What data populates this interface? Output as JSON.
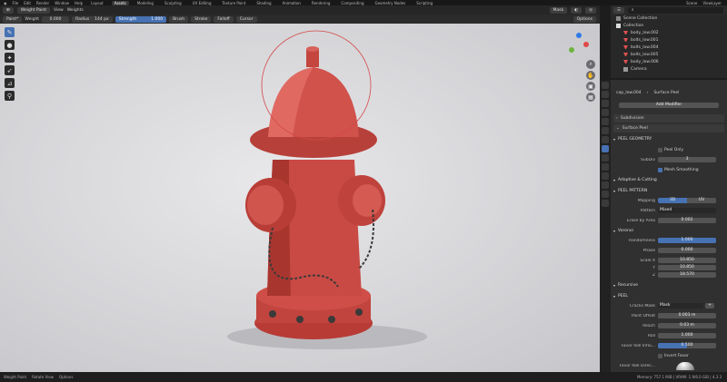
{
  "menubar": {
    "items": [
      "File",
      "Edit",
      "Render",
      "Window",
      "Help"
    ],
    "workspaces": [
      "Layout",
      "Assets",
      "Modeling",
      "Sculpting",
      "UV Editing",
      "Texture Paint",
      "Shading",
      "Animation",
      "Rendering",
      "Compositing",
      "Geometry Nodes",
      "Scripting"
    ],
    "active_workspace": "Assets",
    "right": [
      "Scene",
      "ViewLayer"
    ]
  },
  "header": {
    "mode": "Weight Paint",
    "menus": [
      "View",
      "Weights"
    ],
    "mask_label": "Mask"
  },
  "tool_header": {
    "brush": "Paint*",
    "weight_label": "Weight",
    "weight_value": "0.000",
    "radius_label": "Radius",
    "radius_value": "144 px",
    "strength_label": "Strength",
    "strength_value": "1.000",
    "dropdowns": [
      "Brush",
      "Stroke",
      "Falloff",
      "Cursor"
    ],
    "options": "Options"
  },
  "outliner": {
    "title": "Scene Collection",
    "collection": "Collection",
    "items": [
      "body_low.002",
      "bolts_low.001",
      "bolts_low.004",
      "bolts_low.005",
      "body_low.006",
      "Camera"
    ]
  },
  "properties": {
    "object": "cap_low.004",
    "modifier_breadcrumb": "Surface Peel",
    "add_modifier": "Add Modifier",
    "modifiers": [
      "Subdivision",
      "Surface Peel"
    ],
    "peel_geometry": {
      "title": "PEEL GEOMETRY",
      "peel_only": "Peel Only",
      "subdiv_label": "SubDiv",
      "subdiv_value": "3",
      "mesh_smoothing": "Mesh Smoothing",
      "adaptive": "Adaptive & Cutting"
    },
    "peel_pattern": {
      "title": "PEEL PATTERN",
      "mapping_label": "Mapping",
      "mapping_options": [
        "3D",
        "UV"
      ],
      "pattern_label": "Pattern",
      "pattern_value": "Mixed",
      "erase_label": "Erase by Area",
      "erase_value": "0.002",
      "voronoi": "Voronoi",
      "randomness_label": "Randomness",
      "randomness_value": "1.000",
      "phase_label": "Phase",
      "phase_value": "0.000",
      "scale_x_label": "Scale X",
      "scale_x_value": "10.850",
      "scale_y_label": "Y",
      "scale_y_value": "10.850",
      "scale_z_label": "Z",
      "scale_z_value": "18.570",
      "recursive": "Recursive"
    },
    "peel": {
      "title": "PEEL",
      "cracks_label": "Cracks Mask",
      "cracks_value": "Mask",
      "offset_label": "Paint Offset",
      "offset_value": "0.003 m",
      "reach_label": "Reach",
      "reach_value": "0.03 m",
      "roll_label": "Roll",
      "roll_value": "1.000",
      "favor_label": "Favor Roll Influ...",
      "favor_value": "0.500",
      "invert_label": "Invert Favor",
      "favor_dir_label": "Favor Roll Direc..."
    }
  },
  "status": {
    "left": [
      "Weight Paint",
      "Rotate View",
      "Options"
    ],
    "right": "Memory: 757.1 MiB | VRAM: 1.9/6.0 GiB | 4.3.3"
  }
}
